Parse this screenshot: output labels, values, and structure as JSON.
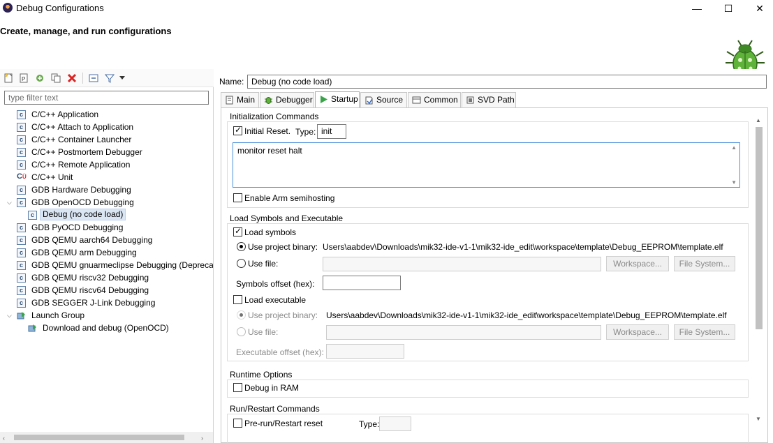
{
  "window": {
    "title": "Debug Configurations",
    "minimize": "—",
    "maximize": "☐",
    "close": "✕"
  },
  "header": {
    "heading": "Create, manage, and run configurations"
  },
  "filter": {
    "placeholder": "type filter text"
  },
  "tree": [
    {
      "label": "C/C++ Application",
      "icon": "c-icon",
      "level": 1
    },
    {
      "label": "C/C++ Attach to Application",
      "icon": "c-icon",
      "level": 1
    },
    {
      "label": "C/C++ Container Launcher",
      "icon": "c-icon",
      "level": 1
    },
    {
      "label": "C/C++ Postmortem Debugger",
      "icon": "c-icon",
      "level": 1
    },
    {
      "label": "C/C++ Remote Application",
      "icon": "c-icon",
      "level": 1
    },
    {
      "label": "C/C++ Unit",
      "icon": "cu-icon",
      "level": 1
    },
    {
      "label": "GDB Hardware Debugging",
      "icon": "c-icon",
      "level": 1
    },
    {
      "label": "GDB OpenOCD Debugging",
      "icon": "c-icon",
      "level": 1,
      "expanded": true
    },
    {
      "label": "Debug (no code load)",
      "icon": "c-icon",
      "level": 2,
      "selected": true
    },
    {
      "label": "GDB PyOCD Debugging",
      "icon": "c-icon",
      "level": 1
    },
    {
      "label": "GDB QEMU aarch64 Debugging",
      "icon": "c-icon",
      "level": 1
    },
    {
      "label": "GDB QEMU arm Debugging",
      "icon": "c-icon",
      "level": 1
    },
    {
      "label": "GDB QEMU gnuarmeclipse Debugging (Deprecated)",
      "icon": "c-icon",
      "level": 1
    },
    {
      "label": "GDB QEMU riscv32 Debugging",
      "icon": "c-icon",
      "level": 1
    },
    {
      "label": "GDB QEMU riscv64 Debugging",
      "icon": "c-icon",
      "level": 1
    },
    {
      "label": "GDB SEGGER J-Link Debugging",
      "icon": "c-icon",
      "level": 1
    },
    {
      "label": "Launch Group",
      "icon": "launch-group-icon",
      "level": 1,
      "expanded": true
    },
    {
      "label": "Download and debug (OpenOCD)",
      "icon": "launch-group-icon",
      "level": 2
    }
  ],
  "config": {
    "name_label": "Name:",
    "name_value": "Debug (no code load)"
  },
  "tabs": [
    {
      "label": "Main",
      "icon": "main-tab-icon"
    },
    {
      "label": "Debugger",
      "icon": "debugger-tab-icon"
    },
    {
      "label": "Startup",
      "icon": "startup-tab-icon",
      "active": true
    },
    {
      "label": "Source",
      "icon": "source-tab-icon"
    },
    {
      "label": "Common",
      "icon": "common-tab-icon"
    },
    {
      "label": "SVD Path",
      "icon": "svd-tab-icon"
    }
  ],
  "startup": {
    "init_title": "Initialization Commands",
    "initial_reset_label": "Initial Reset.",
    "type_label": "Type:",
    "type_value": "init",
    "init_commands": "monitor reset halt",
    "semihosting_label": "Enable Arm semihosting",
    "load_title": "Load Symbols and Executable",
    "load_symbols_label": "Load symbols",
    "use_project_binary_label": "Use project binary:",
    "project_binary_path": "Users\\aabdev\\Downloads\\mik32-ide-v1-1\\mik32-ide_edit\\workspace\\template\\Debug_EEPROM\\template.elf",
    "use_file_label": "Use file:",
    "workspace_button": "Workspace...",
    "file_system_button": "File System...",
    "symbols_offset_label": "Symbols offset (hex):",
    "load_executable_label": "Load executable",
    "exec_project_binary_path": "Users\\aabdev\\Downloads\\mik32-ide-v1-1\\mik32-ide_edit\\workspace\\template\\Debug_EEPROM\\template.elf",
    "executable_offset_label": "Executable offset (hex):",
    "runtime_title": "Runtime Options",
    "debug_in_ram_label": "Debug in RAM",
    "restart_title": "Run/Restart Commands",
    "prerun_reset_label": "Pre-run/Restart reset",
    "prerun_type_label": "Type:"
  }
}
